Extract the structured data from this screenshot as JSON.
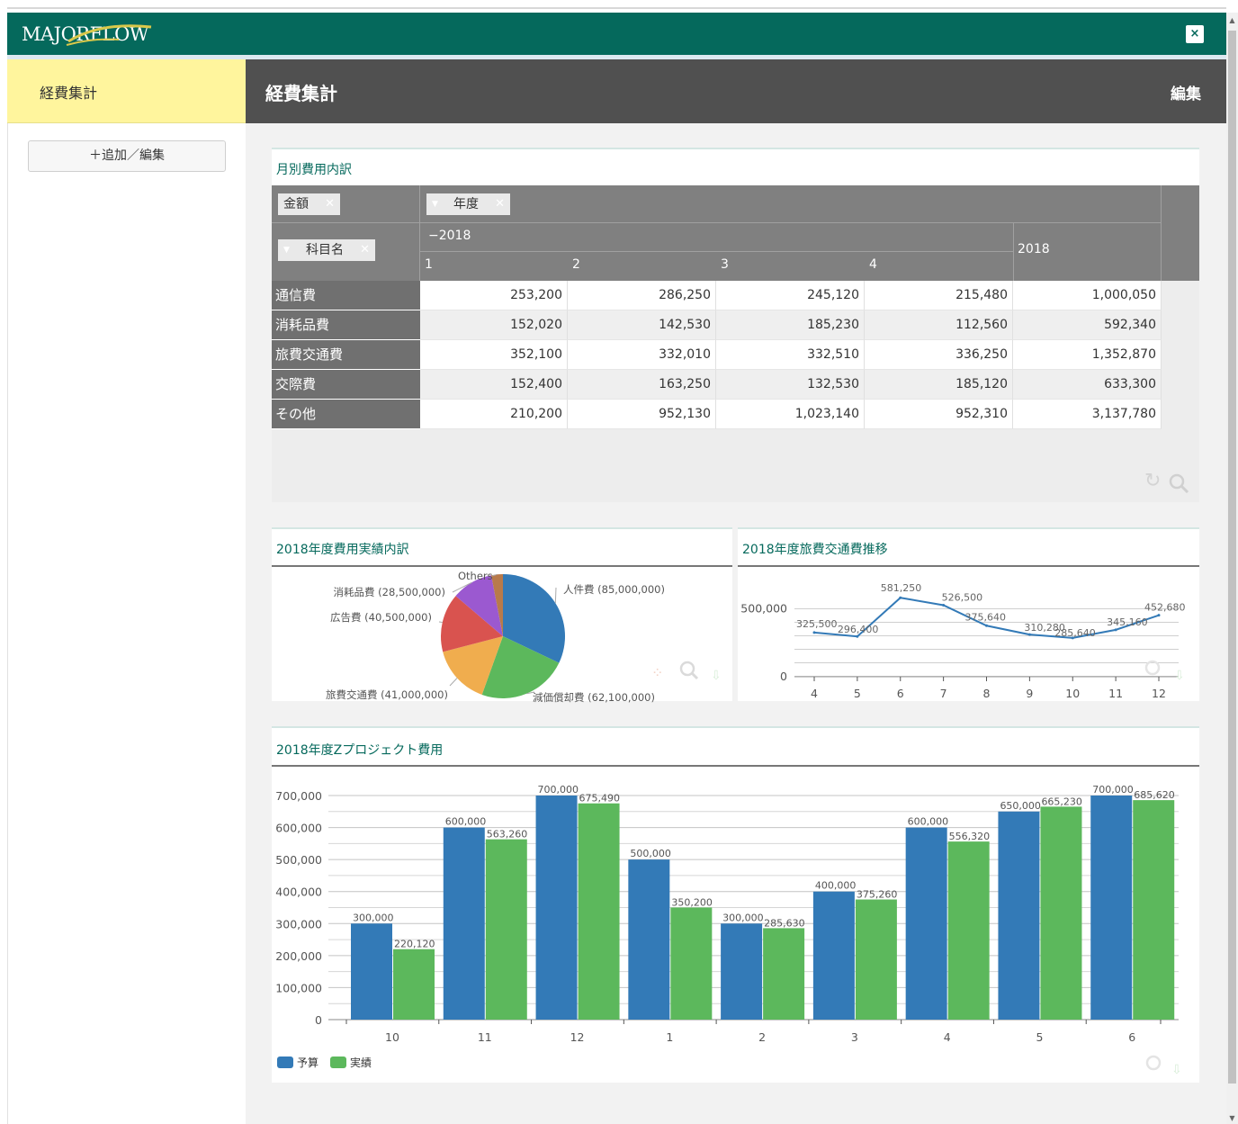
{
  "app": {
    "logo": "MAJORFLOW",
    "close": "×"
  },
  "sidebar": {
    "title": "経費集計",
    "add_button": "＋追加／編集"
  },
  "header": {
    "title": "経費集計",
    "edit": "編集"
  },
  "colors": {
    "titlebar": "#05695c",
    "sidebar_active": "#fff59d",
    "header": "#505050",
    "blue": "#337ab7",
    "green": "#5cb85c"
  },
  "pivot": {
    "title": "月別費用内訳",
    "value_chip": "金額",
    "column_chip": "年度",
    "row_chip": "科目名",
    "year_group": "2018",
    "year_total": "2018",
    "months": [
      "1",
      "2",
      "3",
      "4"
    ],
    "rows": [
      {
        "label": "通信費",
        "values": [
          "253,200",
          "286,250",
          "245,120",
          "215,480"
        ],
        "total": "1,000,050"
      },
      {
        "label": "消耗品費",
        "values": [
          "152,020",
          "142,530",
          "185,230",
          "112,560"
        ],
        "total": "592,340"
      },
      {
        "label": "旅費交通費",
        "values": [
          "352,100",
          "332,010",
          "332,510",
          "336,250"
        ],
        "total": "1,352,870"
      },
      {
        "label": "交際費",
        "values": [
          "152,400",
          "163,250",
          "132,530",
          "185,120"
        ],
        "total": "633,300"
      },
      {
        "label": "その他",
        "values": [
          "210,200",
          "952,130",
          "1,023,140",
          "952,310"
        ],
        "total": "3,137,780"
      }
    ]
  },
  "chart_data": [
    {
      "type": "pie",
      "title": "2018年度費用実績内訳",
      "labels": [
        "人件費 (85,000,000)",
        "減価償却費 (62,100,000)",
        "旅費交通費 (41,000,000)",
        "広告費 (40,500,000)",
        "消耗品費 (28,500,000)",
        "Others"
      ],
      "categories": [
        "人件費",
        "減価償却費",
        "旅費交通費",
        "広告費",
        "消耗品費",
        "Others"
      ],
      "values": [
        85000000,
        62100000,
        41000000,
        40500000,
        28500000,
        8000000
      ],
      "colors": [
        "#337ab7",
        "#5cb85c",
        "#f0ad4e",
        "#d9534f",
        "#9b59d0",
        "#b87a4b"
      ]
    },
    {
      "type": "line",
      "title": "2018年度旅費交通費推移",
      "x": [
        "4",
        "5",
        "6",
        "7",
        "8",
        "9",
        "10",
        "11",
        "12"
      ],
      "values": [
        325500,
        296400,
        581250,
        526500,
        375640,
        310280,
        285640,
        345160,
        452680
      ],
      "value_labels": [
        "325,500",
        "296,400",
        "581,250",
        "526,500",
        "375,640",
        "310,280",
        "285,640",
        "345,160",
        "452,680"
      ],
      "yticks": [
        "0",
        "500,000"
      ],
      "ylim": [
        0,
        700000
      ]
    },
    {
      "type": "bar",
      "title": "2018年度Zプロジェクト費用",
      "categories": [
        "10",
        "11",
        "12",
        "1",
        "2",
        "3",
        "4",
        "5",
        "6"
      ],
      "series": [
        {
          "name": "予算",
          "values": [
            300000,
            600000,
            700000,
            500000,
            300000,
            400000,
            600000,
            650000,
            700000
          ],
          "labels": [
            "300,000",
            "600,000",
            "700,000",
            "500,000",
            "300,000",
            "400,000",
            "600,000",
            "650,000",
            "700,000"
          ]
        },
        {
          "name": "実績",
          "values": [
            220120,
            563260,
            675490,
            350200,
            285630,
            375260,
            556320,
            665230,
            685620
          ],
          "labels": [
            "220,120",
            "563,260",
            "675,490",
            "350,200",
            "285,630",
            "375,260",
            "556,320",
            "665,230",
            "685,620"
          ]
        }
      ],
      "yticks": [
        "0",
        "100,000",
        "200,000",
        "300,000",
        "400,000",
        "500,000",
        "600,000",
        "700,000"
      ],
      "ylim": [
        0,
        700000
      ],
      "legend": "bottom-left"
    }
  ]
}
